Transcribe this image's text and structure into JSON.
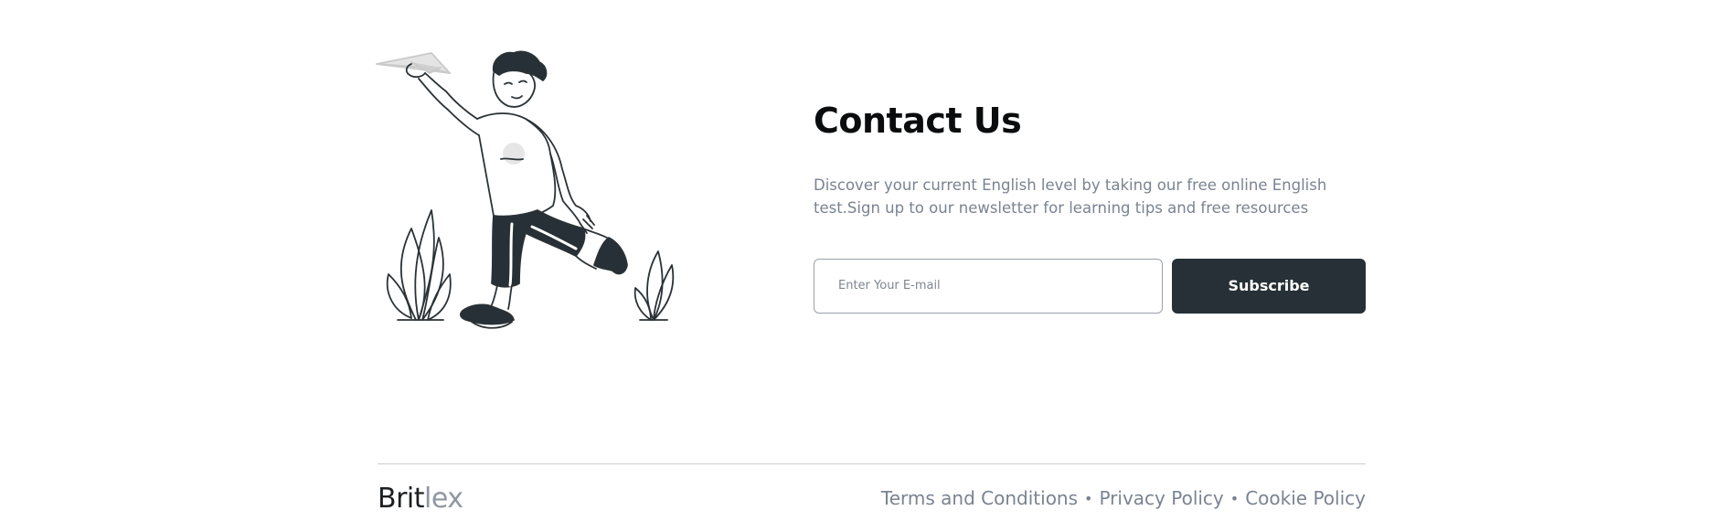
{
  "contact": {
    "title": "Contact Us",
    "description": "Discover your current English level by taking our free online English test.Sign up to our newsletter for learning tips and free resources",
    "email_placeholder": "Enter Your E-mail",
    "email_value": "",
    "subscribe_label": "Subscribe"
  },
  "footer": {
    "brand_primary": "Brit",
    "brand_secondary": "lex",
    "links": [
      {
        "label": "Terms and Conditions"
      },
      {
        "label": "Privacy Policy"
      },
      {
        "label": "Cookie Policy"
      }
    ],
    "separator": "•"
  },
  "illustration": {
    "icon": "paper-plane-boy-illustration"
  },
  "colors": {
    "button_bg": "#263036",
    "heading": "#0b0c0d",
    "muted_text": "#7a8391",
    "brand_light": "#8f97a3"
  }
}
